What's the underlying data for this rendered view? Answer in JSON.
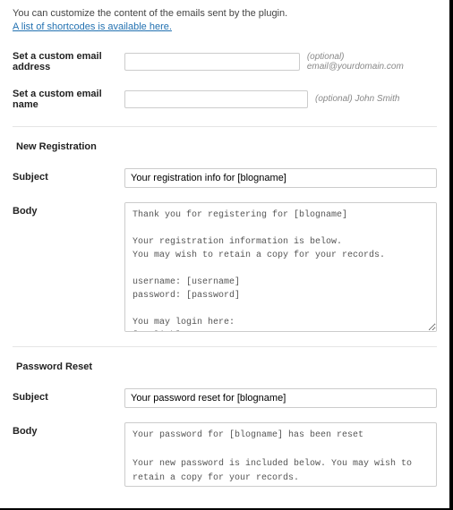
{
  "intro": {
    "line1": "You can customize the content of the emails sent by the plugin.",
    "link_text": "A list of shortcodes is available here."
  },
  "custom_address": {
    "label": "Set a custom email address",
    "value": "",
    "hint": "(optional) email@yourdomain.com"
  },
  "custom_name": {
    "label": "Set a custom email name",
    "value": "",
    "hint": "(optional) John Smith"
  },
  "new_registration": {
    "title": "New Registration",
    "subject_label": "Subject",
    "subject_value": "Your registration info for [blogname]",
    "body_label": "Body",
    "body_value": "Thank you for registering for [blogname]\n\nYour registration information is below.\nYou may wish to retain a copy for your records.\n\nusername: [username]\npassword: [password]\n\nYou may login here:\n[reglink]\n\nYou may change your password here:\n[members-area]"
  },
  "password_reset": {
    "title": "Password Reset",
    "subject_label": "Subject",
    "subject_value": "Your password reset for [blogname]",
    "body_label": "Body",
    "body_value": "Your password for [blogname] has been reset\n\nYour new password is included below. You may wish to retain a copy for your records.\n\npassword: [password]"
  }
}
